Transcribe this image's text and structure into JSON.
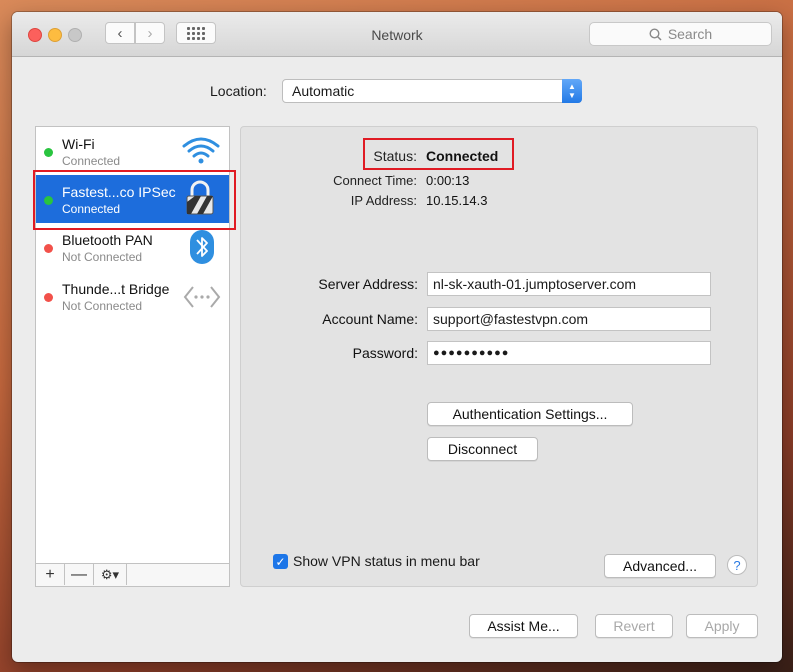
{
  "window": {
    "title": "Network"
  },
  "search": {
    "placeholder": "Search"
  },
  "location": {
    "label": "Location:",
    "value": "Automatic"
  },
  "services": [
    {
      "name": "Wi-Fi",
      "status": "Connected",
      "dot": "#29c43f",
      "icon": "wifi-icon"
    },
    {
      "name": "Fastest...co IPSec",
      "status": "Connected",
      "dot": "#29c43f",
      "icon": "lock-icon"
    },
    {
      "name": "Bluetooth PAN",
      "status": "Not Connected",
      "dot": "#f2514a",
      "icon": "bluetooth-icon"
    },
    {
      "name": "Thunde...t Bridge",
      "status": "Not Connected",
      "dot": "#f2514a",
      "icon": "bridge-icon"
    }
  ],
  "sidebar_controls": {
    "add": "+",
    "remove": "—",
    "action": "⚙▾"
  },
  "details": {
    "status_label": "Status:",
    "status_value": "Connected",
    "connect_time_label": "Connect Time:",
    "connect_time_value": "0:00:13",
    "ip_label": "IP Address:",
    "ip_value": "10.15.14.3",
    "server_label": "Server Address:",
    "server_value": "nl-sk-xauth-01.jumptoserver.com",
    "account_label": "Account Name:",
    "account_value": "support@fastestvpn.com",
    "password_label": "Password:",
    "password_value": "●●●●●●●●●●",
    "auth_button": "Authentication Settings...",
    "disconnect_button": "Disconnect",
    "show_vpn_label": "Show VPN status in menu bar",
    "advanced_button": "Advanced...",
    "help": "?"
  },
  "footer": {
    "assist": "Assist Me...",
    "revert": "Revert",
    "apply": "Apply"
  },
  "colors": {
    "accent": "#1d6ddc",
    "highlight": "#e01b24"
  }
}
